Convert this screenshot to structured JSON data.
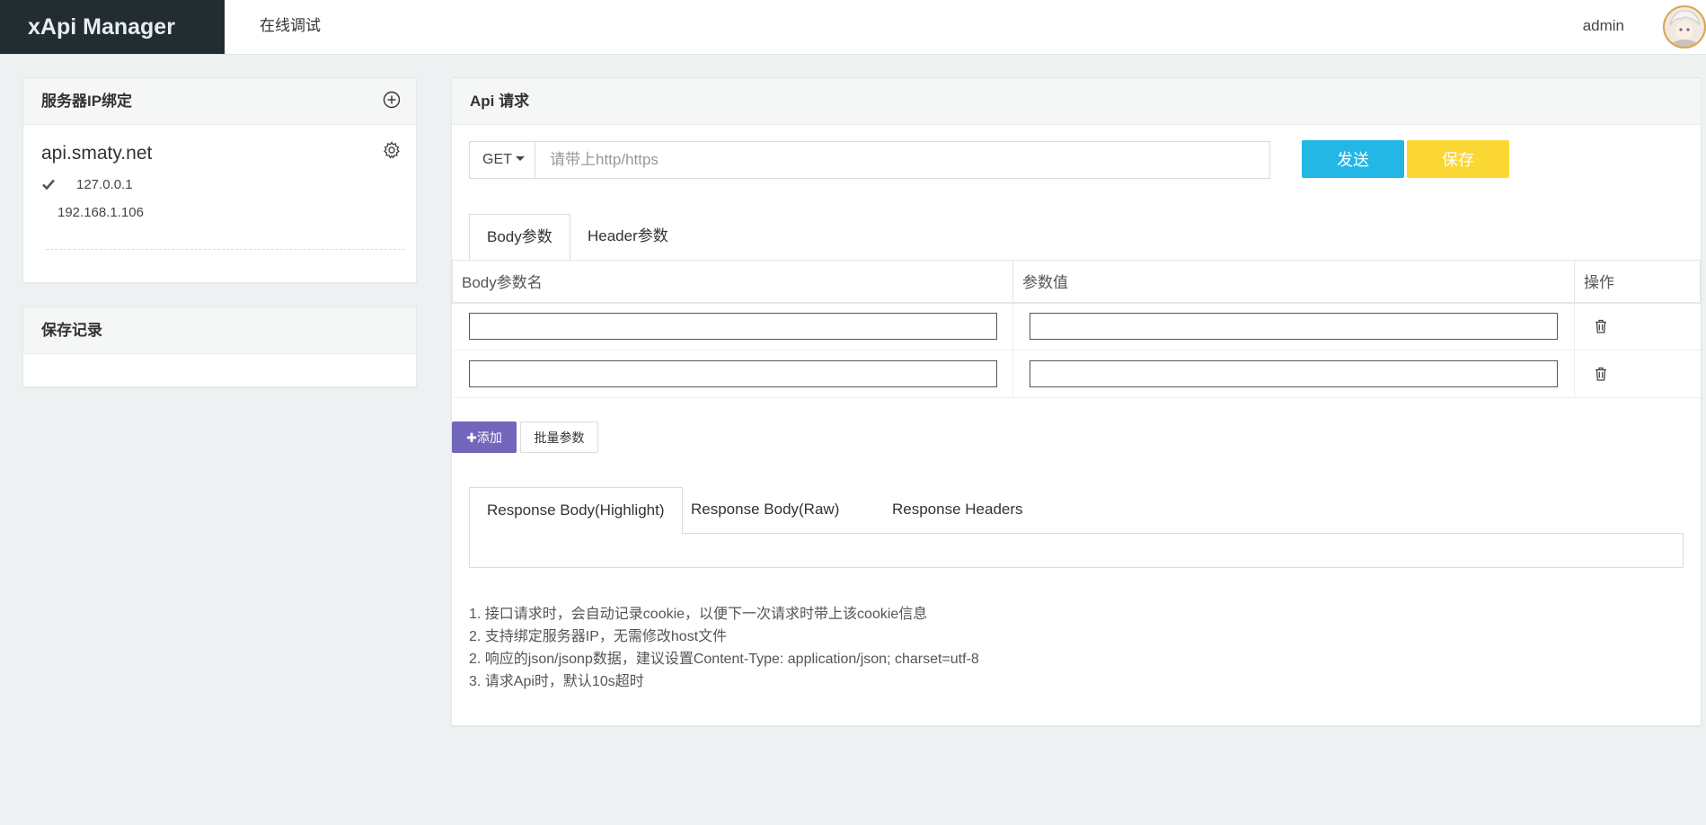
{
  "header": {
    "brand": "xApi Manager",
    "nav_link": "在线调试",
    "user_name": "admin",
    "avatar_icon": "user-avatar"
  },
  "bind_panel": {
    "title": "服务器IP绑定",
    "add_icon": "plus-circle-icon",
    "host": "api.smaty.net",
    "settings_icon": "gear-icon",
    "ips": [
      {
        "ip": "127.0.0.1",
        "selected": true
      },
      {
        "ip": "192.168.1.106",
        "selected": false
      }
    ]
  },
  "save_panel": {
    "title": "保存记录"
  },
  "request": {
    "title": "Api 请求",
    "method": "GET",
    "url_placeholder": "请带上http/https",
    "url_value": "",
    "send_label": "发送",
    "save_label": "保存",
    "colors": {
      "send": "#23b7e5",
      "save": "#fad733",
      "add": "#7266ba"
    }
  },
  "param_tabs": [
    {
      "label": "Body参数",
      "active": true
    },
    {
      "label": "Header参数",
      "active": false
    }
  ],
  "param_table": {
    "columns": [
      "Body参数名",
      "参数值",
      "操作"
    ],
    "rows": [
      {
        "name": "",
        "value": ""
      },
      {
        "name": "",
        "value": ""
      }
    ]
  },
  "buttons": {
    "add_label": "添加",
    "batch_label": "批量参数"
  },
  "response_tabs": [
    {
      "label": "Response Body(Highlight)",
      "active": true
    },
    {
      "label": "Response Body(Raw)",
      "active": false
    },
    {
      "label": "Response Headers",
      "active": false
    }
  ],
  "notes": [
    "1. 接口请求时，会自动记录cookie，以便下一次请求时带上该cookie信息",
    "2. 支持绑定服务器IP，无需修改host文件",
    "2. 响应的json/jsonp数据，建议设置Content-Type: application/json; charset=utf-8",
    "3. 请求Api时，默认10s超时"
  ]
}
